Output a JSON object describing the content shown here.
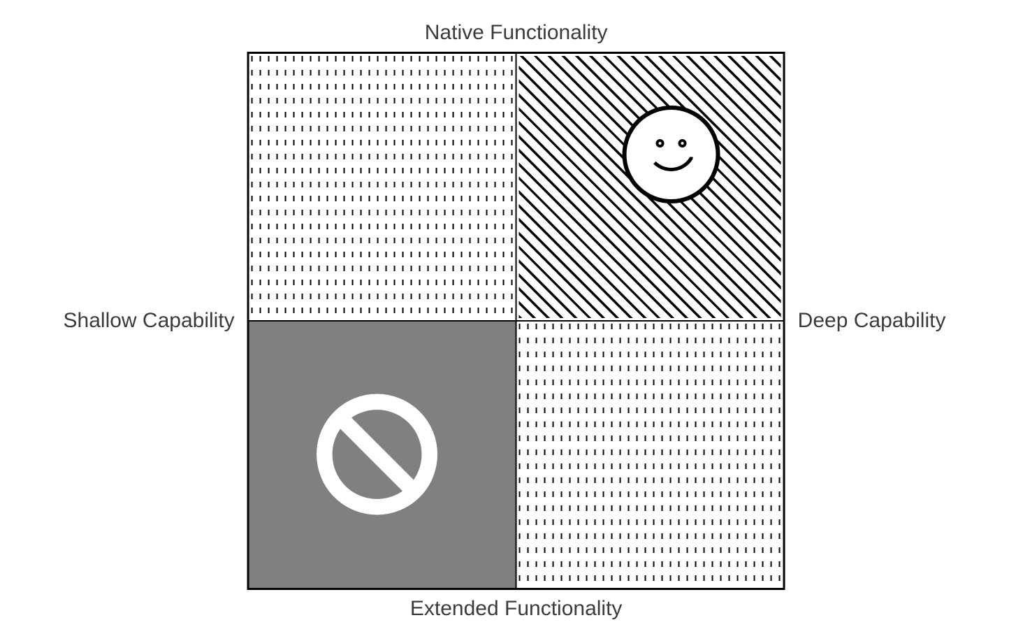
{
  "chart_data": {
    "type": "matrix-2x2",
    "axes": {
      "top": "Native Functionality",
      "bottom": "Extended Functionality",
      "left": "Shallow Capability",
      "right": "Deep Capability"
    },
    "quadrants": [
      {
        "position": "top-left",
        "row_label": "Native Functionality",
        "col_label": "Shallow Capability",
        "fill": "dashed-vertical",
        "icon": null,
        "classification": "neutral"
      },
      {
        "position": "top-right",
        "row_label": "Native Functionality",
        "col_label": "Deep Capability",
        "fill": "diagonal-hatch",
        "icon": "smiley-face",
        "classification": "desirable"
      },
      {
        "position": "bottom-left",
        "row_label": "Extended Functionality",
        "col_label": "Shallow Capability",
        "fill": "solid-gray",
        "icon": "prohibited",
        "classification": "undesirable"
      },
      {
        "position": "bottom-right",
        "row_label": "Extended Functionality",
        "col_label": "Deep Capability",
        "fill": "dashed-vertical",
        "icon": null,
        "classification": "neutral"
      }
    ]
  },
  "labels": {
    "top": "Native Functionality",
    "bottom": "Extended Functionality",
    "left": "Shallow Capability",
    "right": "Deep Capability"
  }
}
